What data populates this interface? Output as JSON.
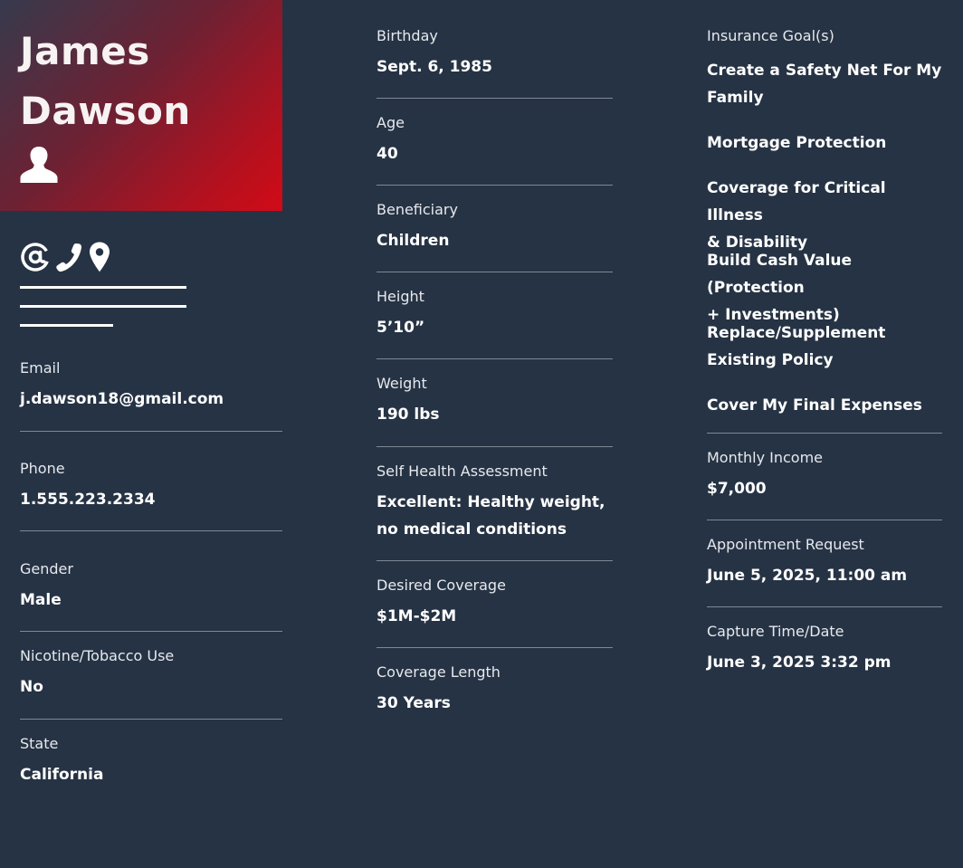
{
  "profile": {
    "first_name": "James",
    "last_name": "Dawson",
    "icons": [
      "person-icon",
      "at-sign-icon",
      "phone-icon",
      "location-pin-icon"
    ],
    "colors": {
      "background": "#263344",
      "accent_red": "#d20a17",
      "accent_dark": "#363a4d"
    }
  },
  "left_fields": {
    "email": {
      "label": "Email",
      "value": "j.dawson18@gmail.com"
    },
    "phone": {
      "label": "Phone",
      "value": "1.555.223.2334"
    },
    "gender": {
      "label": "Gender",
      "value": "Male"
    },
    "tobacco": {
      "label": "Nicotine/Tobacco Use",
      "value": "No"
    },
    "state": {
      "label": "State",
      "value": "California"
    }
  },
  "middle_fields": {
    "birthday": {
      "label": "Birthday",
      "value": "Sept. 6, 1985"
    },
    "age": {
      "label": "Age",
      "value": "40"
    },
    "beneficiary": {
      "label": "Beneficiary",
      "value": "Children"
    },
    "height": {
      "label": "Height",
      "value": "5’10”"
    },
    "weight": {
      "label": "Weight",
      "value": "190 lbs"
    },
    "health": {
      "label": "Self Health Assessment",
      "line1": "Excellent: Healthy weight,",
      "line2": "no medical conditions"
    },
    "coverage": {
      "label": "Desired Coverage",
      "value": "$1M-$2M"
    },
    "length": {
      "label": "Coverage Length",
      "value": "30 Years"
    }
  },
  "right_fields": {
    "goals": {
      "label": "Insurance Goal(s)",
      "items": [
        {
          "line1": "Create a Safety Net For My",
          "line2": "Family"
        },
        {
          "line1": "Mortgage Protection"
        },
        {
          "line1": "Coverage for Critical Illness",
          "line2": "& Disability"
        },
        {
          "line1": "Build Cash Value (Protection",
          "line2": "+ Investments)"
        },
        {
          "line1": "Replace/Supplement",
          "line2": "Existing Policy"
        },
        {
          "line1": "Cover My Final Expenses"
        }
      ]
    },
    "income": {
      "label": "Monthly Income",
      "value": "$7,000"
    },
    "appointment": {
      "label": "Appointment Request",
      "value": "June 5, 2025, 11:00 am"
    },
    "capture": {
      "label": "Capture Time/Date",
      "value": "June 3, 2025 3:32 pm"
    }
  }
}
